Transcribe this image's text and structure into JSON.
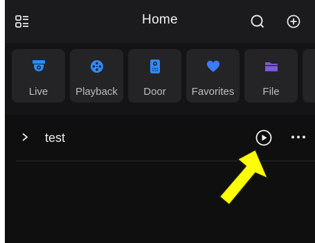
{
  "header": {
    "title": "Home",
    "icons": [
      "menu-icon",
      "search-icon",
      "add-icon"
    ]
  },
  "quick_access": [
    {
      "label": "Live",
      "icon": "camera-icon",
      "color": "#2f8cff"
    },
    {
      "label": "Playback",
      "icon": "film-reel-icon",
      "color": "#2f8cff"
    },
    {
      "label": "Door",
      "icon": "intercom-icon",
      "color": "#2f8cff"
    },
    {
      "label": "Favorites",
      "icon": "heart-icon",
      "color": "#3b7bff"
    },
    {
      "label": "File",
      "icon": "folder-icon",
      "color": "#7b5bd6"
    }
  ],
  "devices": [
    {
      "label": "test",
      "expanded": false
    }
  ],
  "annotation": {
    "color": "#ffff00",
    "points_to": "play-button"
  }
}
